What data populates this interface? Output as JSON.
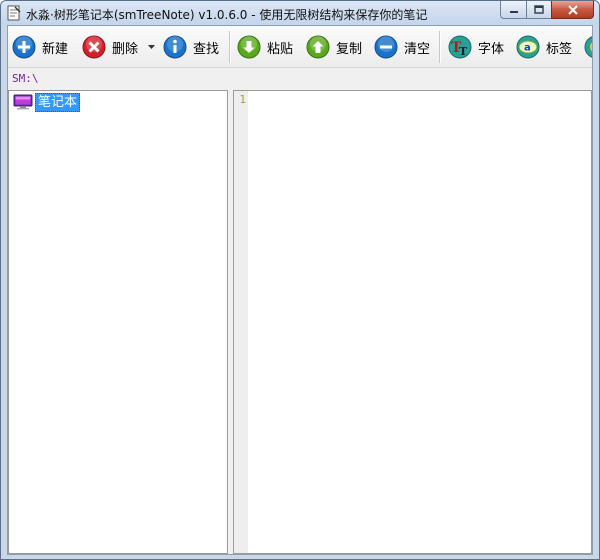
{
  "window": {
    "title": "水淼·树形笔记本(smTreeNote) v1.0.6.0 - 使用无限树结构来保存你的笔记"
  },
  "toolbar": {
    "buttons": [
      {
        "id": "new",
        "label": "新建",
        "icon": "plus-circle-icon",
        "color": "#1a73c9"
      },
      {
        "id": "delete",
        "label": "删除",
        "icon": "x-circle-icon",
        "color": "#d3212b"
      },
      {
        "id": "find",
        "label": "查找",
        "icon": "info-circle-icon",
        "color": "#1a73c9"
      },
      {
        "id": "paste",
        "label": "粘贴",
        "icon": "arrow-down-circle-icon",
        "color": "#5aa91c"
      },
      {
        "id": "copy",
        "label": "复制",
        "icon": "arrow-up-circle-icon",
        "color": "#5aa91c"
      },
      {
        "id": "clear",
        "label": "清空",
        "icon": "minus-circle-icon",
        "color": "#1a73c9"
      },
      {
        "id": "font",
        "label": "字体",
        "icon": "font-icon",
        "color": "#2aa198"
      },
      {
        "id": "tag",
        "label": "标签",
        "icon": "tag-icon",
        "color": "#2aa198"
      }
    ]
  },
  "path": {
    "text": "SM:\\"
  },
  "tree": {
    "root": {
      "label": "笔记本",
      "icon": "monitor-icon"
    }
  },
  "editor": {
    "line_numbers": [
      "1"
    ]
  }
}
